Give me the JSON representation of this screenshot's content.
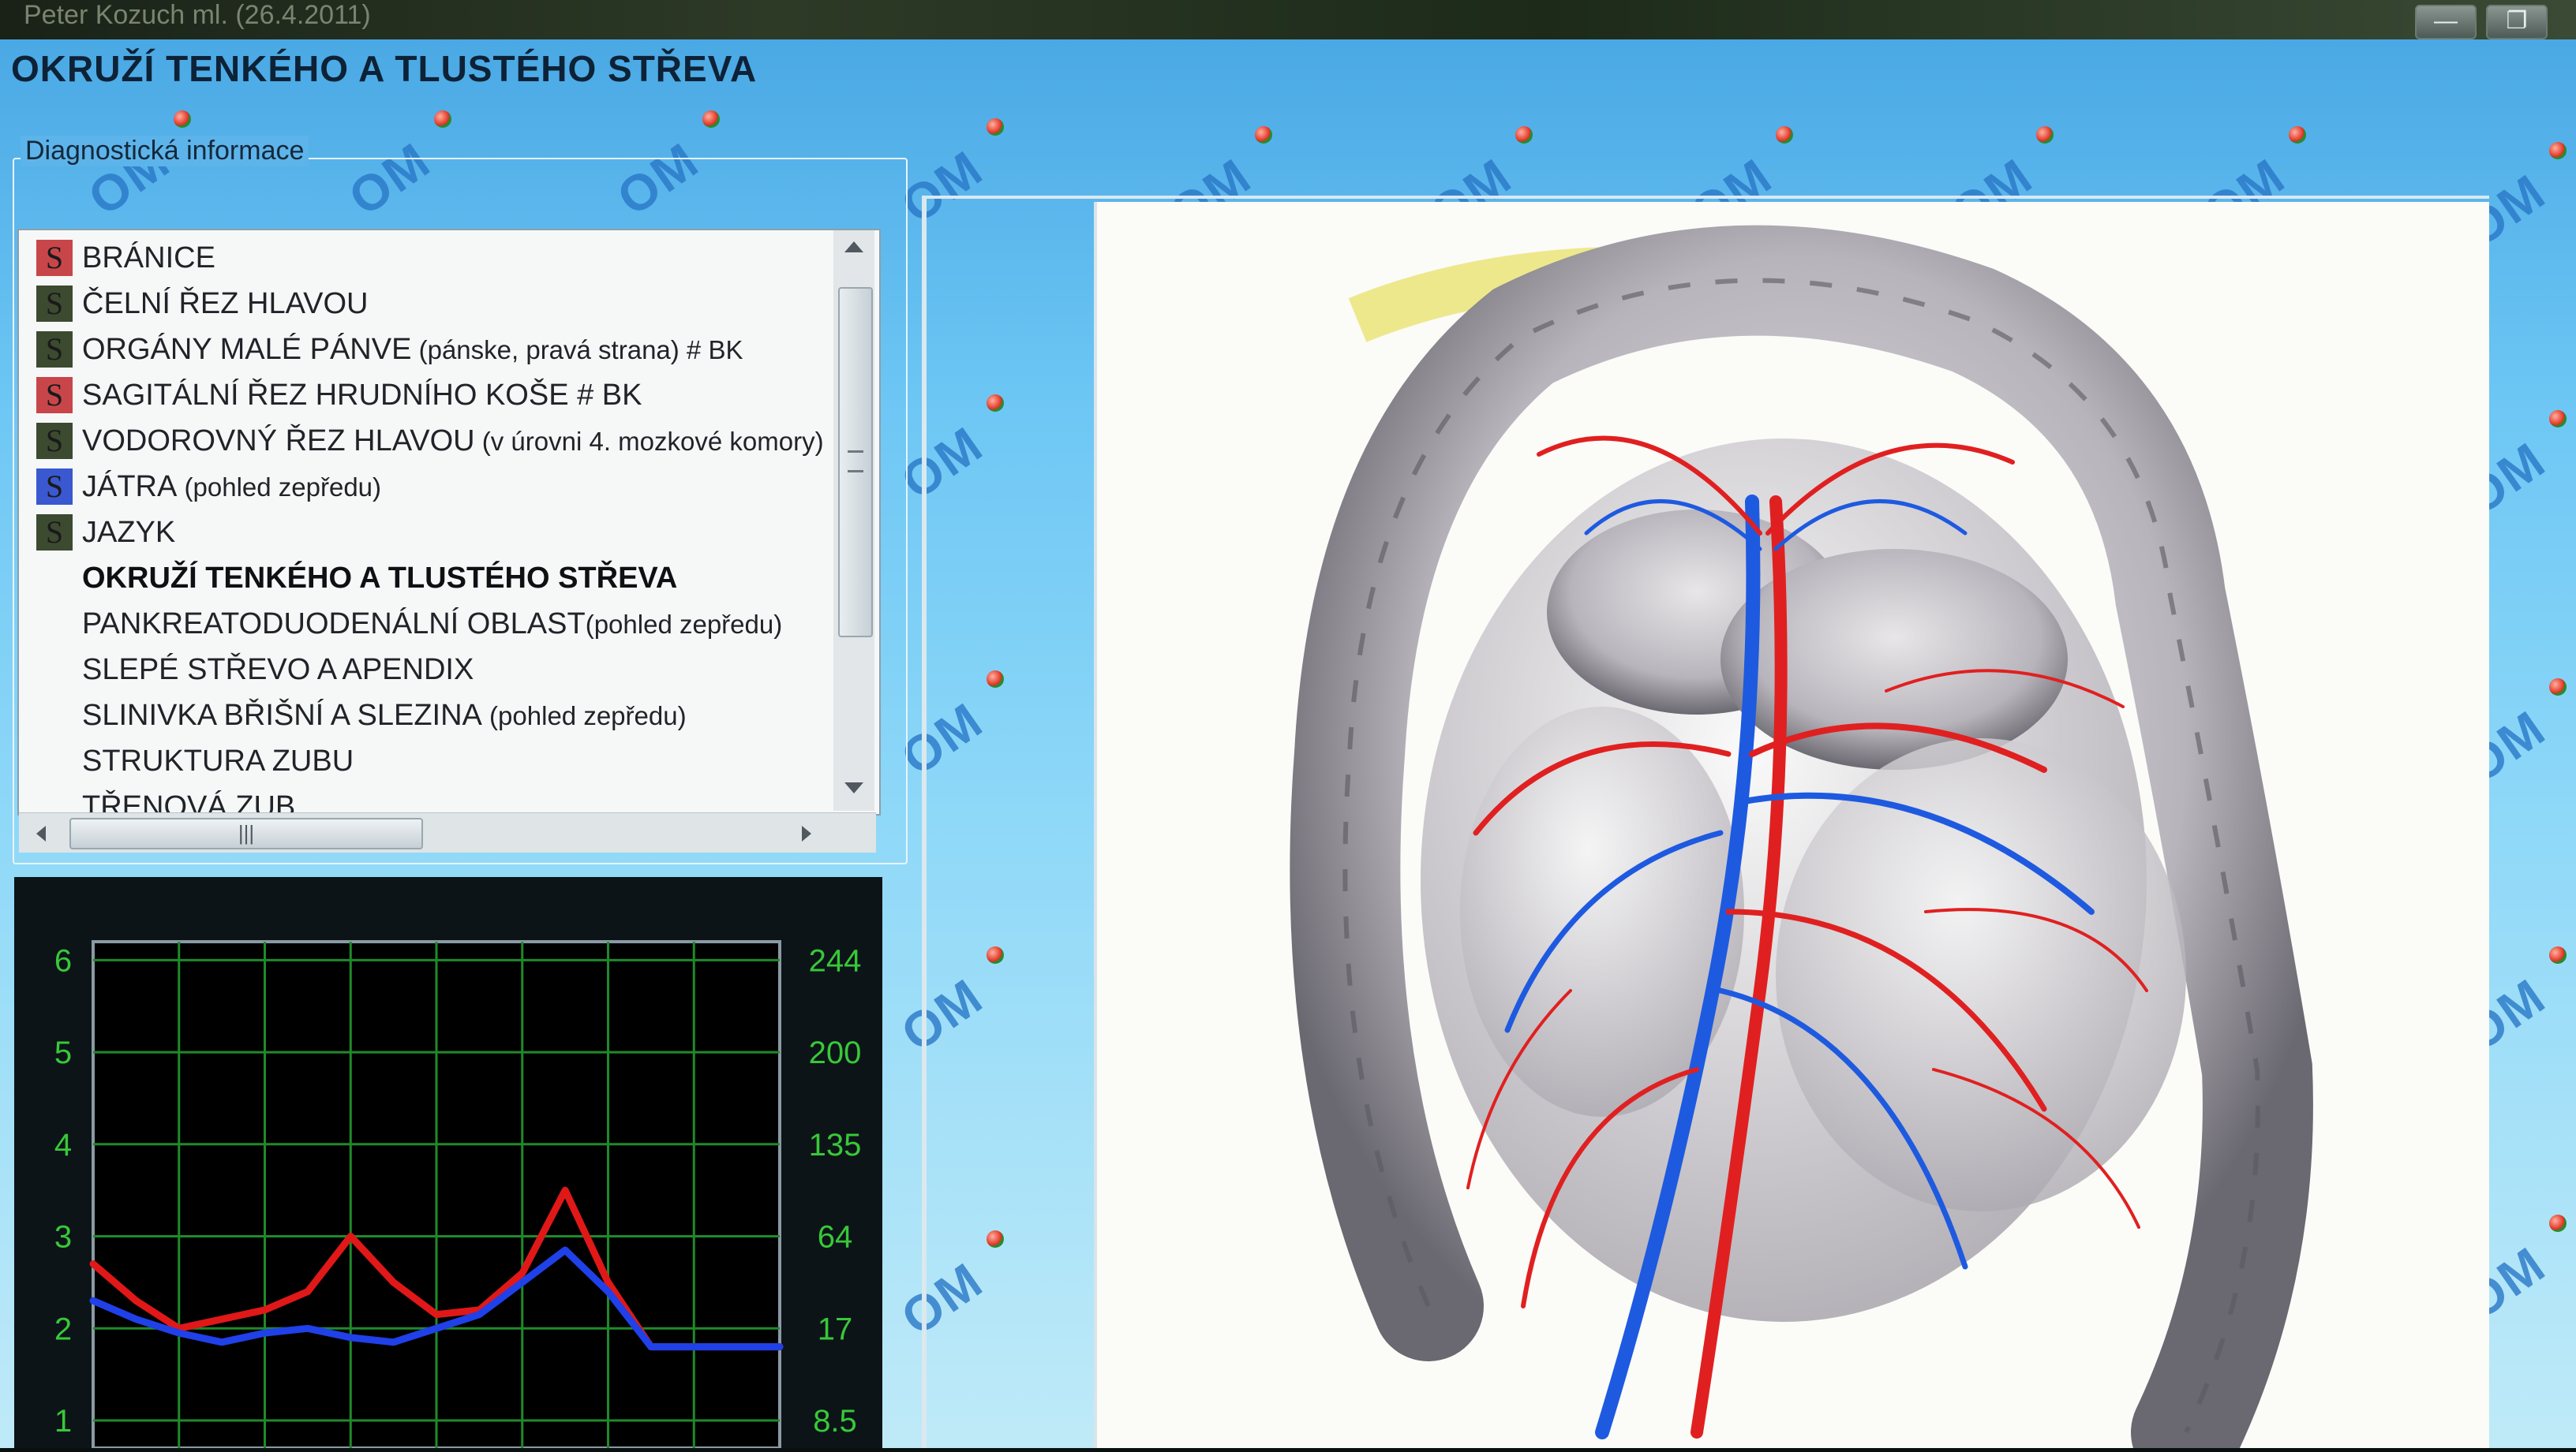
{
  "window": {
    "title": "Peter Kozuch ml. (26.4.2011)",
    "minimize_glyph": "—",
    "restore_glyph": "❐"
  },
  "app": {
    "section_title": "OKRUŽÍ TENKÉHO A TLUSTÉHO STŘEVA",
    "watermark": "OM"
  },
  "diag": {
    "group_label": "Diagnostická informace",
    "items": [
      {
        "label": "BRÁNICE",
        "note": "",
        "icon": "S",
        "icon_color": "#c8464a",
        "selected": false
      },
      {
        "label": "ČELNÍ ŘEZ HLAVOU",
        "note": "",
        "icon": "S",
        "icon_color": "#3c4a30",
        "selected": false
      },
      {
        "label": "ORGÁNY MALÉ PÁNVE",
        "note": " (pánske, pravá strana) # BK",
        "icon": "S",
        "icon_color": "#3c4a30",
        "selected": false
      },
      {
        "label": "SAGITÁLNÍ ŘEZ HRUDNÍHO KOŠE # BK",
        "note": "",
        "icon": "S",
        "icon_color": "#c8464a",
        "selected": false
      },
      {
        "label": "VODOROVNÝ ŘEZ HLAVOU",
        "note": " (v úrovni 4. mozkové komory)",
        "icon": "S",
        "icon_color": "#3c4a30",
        "selected": false
      },
      {
        "label": "JÁTRA",
        "note": " (pohled zepředu)",
        "icon": "S",
        "icon_color": "#3a58d0",
        "selected": false
      },
      {
        "label": "JAZYK",
        "note": "",
        "icon": "S",
        "icon_color": "#3c4a30",
        "selected": false
      },
      {
        "label": "OKRUŽÍ TENKÉHO A TLUSTÉHO STŘEVA",
        "note": "",
        "icon": "",
        "icon_color": "",
        "selected": true
      },
      {
        "label": "PANKREATODUODENÁLNÍ OBLAST",
        "note": "(pohled zepředu)",
        "icon": "",
        "icon_color": "",
        "selected": false
      },
      {
        "label": "SLEPÉ STŘEVO A  APENDIX",
        "note": "",
        "icon": "",
        "icon_color": "",
        "selected": false
      },
      {
        "label": "SLINIVKA BŘIŠNÍ A SLEZINA",
        "note": "  (pohled zepředu)",
        "icon": "",
        "icon_color": "",
        "selected": false
      },
      {
        "label": "STRUKTURA ZUBU",
        "note": "",
        "icon": "",
        "icon_color": "",
        "selected": false
      },
      {
        "label": "TŘENOVÁ ZUB",
        "note": "",
        "icon": "",
        "icon_color": "",
        "selected": false
      }
    ],
    "scroll_grip": "|||"
  },
  "chart_data": {
    "type": "line",
    "left_axis_ticks": [
      "6",
      "5",
      "4",
      "3",
      "2",
      "1"
    ],
    "right_axis_ticks": [
      "244",
      "200",
      "135",
      "64",
      "17",
      "8.5"
    ],
    "x": [
      0,
      0.5,
      1,
      1.5,
      2,
      2.5,
      3,
      3.5,
      4,
      4.5,
      5,
      5.5,
      6,
      6.5,
      7,
      7.5,
      8
    ],
    "ylim": [
      0.7,
      6.2
    ],
    "grid": true,
    "series": [
      {
        "color": "#e01818",
        "values": [
          2.7,
          2.3,
          2.0,
          2.1,
          2.2,
          2.4,
          3.0,
          2.5,
          2.15,
          2.2,
          2.6,
          3.5,
          2.5,
          1.8,
          1.8,
          1.8,
          1.8
        ]
      },
      {
        "color": "#2040e8",
        "values": [
          2.3,
          2.1,
          1.95,
          1.85,
          1.95,
          2.0,
          1.9,
          1.85,
          2.0,
          2.15,
          2.5,
          2.85,
          2.4,
          1.8,
          1.8,
          1.8,
          1.8
        ]
      }
    ]
  },
  "colors": {
    "accent": "#4aa8e4",
    "chart_bg": "#0c1418",
    "grid": "#1f8a2a",
    "tick_text": "#38c838"
  }
}
